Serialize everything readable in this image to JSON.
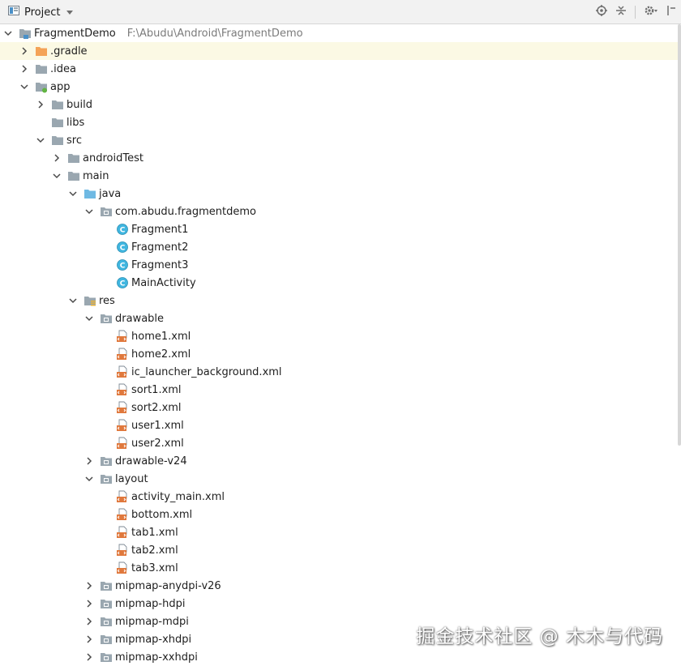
{
  "toolbar": {
    "title": "Project",
    "buttons": [
      {
        "name": "locate-icon"
      },
      {
        "name": "collapse-all-icon"
      },
      {
        "name": "gear-icon"
      },
      {
        "name": "hide-panel-icon"
      }
    ]
  },
  "project_path": "F:\\Abudu\\Android\\FragmentDemo",
  "tree": [
    {
      "label": "FragmentDemo",
      "depth": 0,
      "arrow": "down",
      "icon": "module-folder",
      "name": "tree-item-fragmentdemo",
      "path": true
    },
    {
      "label": ".gradle",
      "depth": 1,
      "arrow": "right",
      "icon": "orange-folder",
      "name": "tree-item-gradle",
      "selected": true
    },
    {
      "label": ".idea",
      "depth": 1,
      "arrow": "right",
      "icon": "folder",
      "name": "tree-item-idea"
    },
    {
      "label": "app",
      "depth": 1,
      "arrow": "down",
      "icon": "module-folder-green",
      "name": "tree-item-app"
    },
    {
      "label": "build",
      "depth": 2,
      "arrow": "right",
      "icon": "folder",
      "name": "tree-item-build"
    },
    {
      "label": "libs",
      "depth": 2,
      "arrow": "none",
      "icon": "folder",
      "name": "tree-item-libs"
    },
    {
      "label": "src",
      "depth": 2,
      "arrow": "down",
      "icon": "folder",
      "name": "tree-item-src"
    },
    {
      "label": "androidTest",
      "depth": 3,
      "arrow": "right",
      "icon": "folder",
      "name": "tree-item-androidtest"
    },
    {
      "label": "main",
      "depth": 3,
      "arrow": "down",
      "icon": "folder",
      "name": "tree-item-main"
    },
    {
      "label": "java",
      "depth": 4,
      "arrow": "down",
      "icon": "blue-folder",
      "name": "tree-item-java"
    },
    {
      "label": "com.abudu.fragmentdemo",
      "depth": 5,
      "arrow": "down",
      "icon": "package",
      "name": "tree-item-package"
    },
    {
      "label": "Fragment1",
      "depth": 6,
      "arrow": "none",
      "icon": "class",
      "name": "tree-item-fragment1"
    },
    {
      "label": "Fragment2",
      "depth": 6,
      "arrow": "none",
      "icon": "class",
      "name": "tree-item-fragment2"
    },
    {
      "label": "Fragment3",
      "depth": 6,
      "arrow": "none",
      "icon": "class",
      "name": "tree-item-fragment3"
    },
    {
      "label": "MainActivity",
      "depth": 6,
      "arrow": "none",
      "icon": "class",
      "name": "tree-item-mainactivity"
    },
    {
      "label": "res",
      "depth": 4,
      "arrow": "down",
      "icon": "res-folder",
      "name": "tree-item-res"
    },
    {
      "label": "drawable",
      "depth": 5,
      "arrow": "down",
      "icon": "package",
      "name": "tree-item-drawable"
    },
    {
      "label": "home1.xml",
      "depth": 6,
      "arrow": "none",
      "icon": "xml",
      "name": "tree-item-home1-xml"
    },
    {
      "label": "home2.xml",
      "depth": 6,
      "arrow": "none",
      "icon": "xml",
      "name": "tree-item-home2-xml"
    },
    {
      "label": "ic_launcher_background.xml",
      "depth": 6,
      "arrow": "none",
      "icon": "xml",
      "name": "tree-item-ic-launcher-background-xml"
    },
    {
      "label": "sort1.xml",
      "depth": 6,
      "arrow": "none",
      "icon": "xml",
      "name": "tree-item-sort1-xml"
    },
    {
      "label": "sort2.xml",
      "depth": 6,
      "arrow": "none",
      "icon": "xml",
      "name": "tree-item-sort2-xml"
    },
    {
      "label": "user1.xml",
      "depth": 6,
      "arrow": "none",
      "icon": "xml",
      "name": "tree-item-user1-xml"
    },
    {
      "label": "user2.xml",
      "depth": 6,
      "arrow": "none",
      "icon": "xml",
      "name": "tree-item-user2-xml"
    },
    {
      "label": "drawable-v24",
      "depth": 5,
      "arrow": "right",
      "icon": "package",
      "name": "tree-item-drawable-v24"
    },
    {
      "label": "layout",
      "depth": 5,
      "arrow": "down",
      "icon": "package",
      "name": "tree-item-layout"
    },
    {
      "label": "activity_main.xml",
      "depth": 6,
      "arrow": "none",
      "icon": "xml",
      "name": "tree-item-activity-main-xml"
    },
    {
      "label": "bottom.xml",
      "depth": 6,
      "arrow": "none",
      "icon": "xml",
      "name": "tree-item-bottom-xml"
    },
    {
      "label": "tab1.xml",
      "depth": 6,
      "arrow": "none",
      "icon": "xml",
      "name": "tree-item-tab1-xml"
    },
    {
      "label": "tab2.xml",
      "depth": 6,
      "arrow": "none",
      "icon": "xml",
      "name": "tree-item-tab2-xml"
    },
    {
      "label": "tab3.xml",
      "depth": 6,
      "arrow": "none",
      "icon": "xml",
      "name": "tree-item-tab3-xml"
    },
    {
      "label": "mipmap-anydpi-v26",
      "depth": 5,
      "arrow": "right",
      "icon": "package",
      "name": "tree-item-mipmap-anydpi-v26"
    },
    {
      "label": "mipmap-hdpi",
      "depth": 5,
      "arrow": "right",
      "icon": "package",
      "name": "tree-item-mipmap-hdpi"
    },
    {
      "label": "mipmap-mdpi",
      "depth": 5,
      "arrow": "right",
      "icon": "package",
      "name": "tree-item-mipmap-mdpi"
    },
    {
      "label": "mipmap-xhdpi",
      "depth": 5,
      "arrow": "right",
      "icon": "package",
      "name": "tree-item-mipmap-xhdpi"
    },
    {
      "label": "mipmap-xxhdpi",
      "depth": 5,
      "arrow": "right",
      "icon": "package",
      "name": "tree-item-mipmap-xxhdpi"
    }
  ],
  "watermark": "掘金技术社区 @ 木木与代码",
  "colors": {
    "selection": "#fbf9e4",
    "folder": "#9aa7b0",
    "orange_folder": "#f4a357",
    "blue_folder": "#6fb9e3",
    "class_icon": "#40b6e0",
    "xml_icon": "#e0783c"
  }
}
